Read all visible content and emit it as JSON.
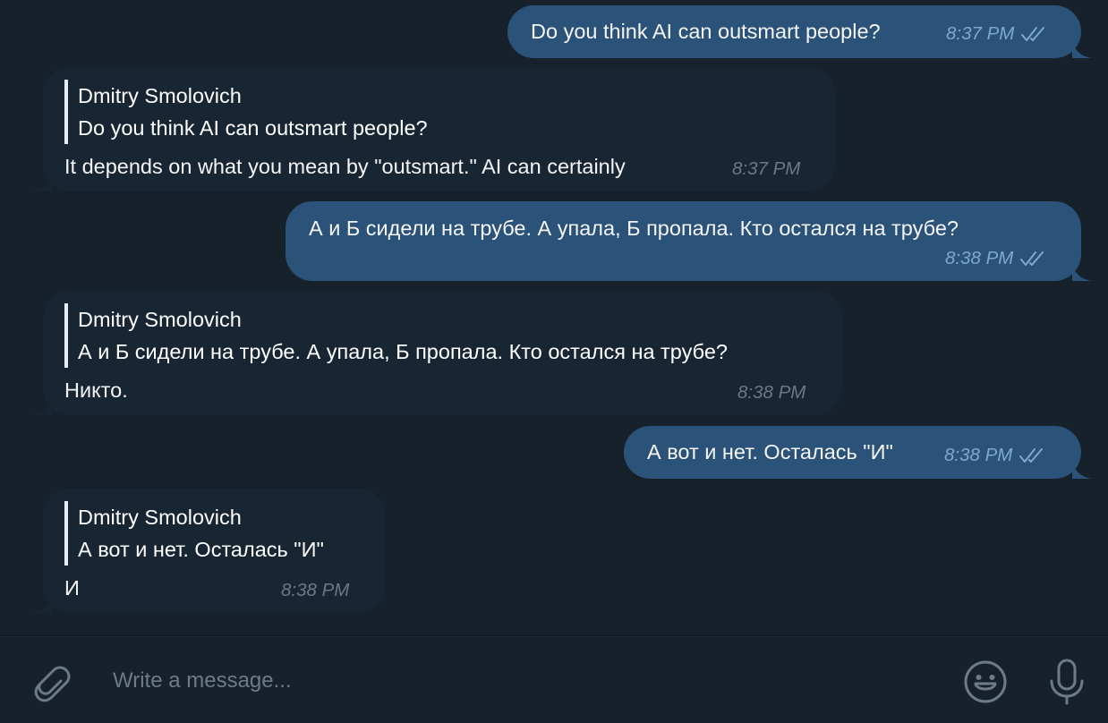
{
  "messages": [
    {
      "direction": "out",
      "text": "Do you think AI can outsmart people?",
      "time": "8:37 PM",
      "read": true
    },
    {
      "direction": "in",
      "reply_sender": "Dmitry Smolovich",
      "reply_text": "Do you think AI can outsmart people?",
      "text": "It depends on what you mean by \"outsmart.\" AI can certainly",
      "time": "8:37 PM"
    },
    {
      "direction": "out",
      "text": "А и Б сидели на трубе. А упала, Б пропала. Кто остался на трубе?",
      "time": "8:38 PM",
      "read": true
    },
    {
      "direction": "in",
      "reply_sender": "Dmitry Smolovich",
      "reply_text": "А и Б сидели на трубе. А упала, Б пропала. Кто остался на трубе?",
      "text": "Никто.",
      "time": "8:38 PM"
    },
    {
      "direction": "out",
      "text": "А вот и нет. Осталась \"И\"",
      "time": "8:38 PM",
      "read": true
    },
    {
      "direction": "in",
      "reply_sender": "Dmitry Smolovich",
      "reply_text": "А вот и нет. Осталась \"И\"",
      "text": "И",
      "time": "8:38 PM"
    }
  ],
  "composer": {
    "placeholder": "Write a message...",
    "value": "",
    "attach_icon": "paperclip-icon",
    "emoji_icon": "smile-icon",
    "voice_icon": "microphone-icon"
  },
  "colors": {
    "background": "#17212b",
    "outgoing_bubble": "#2b5278",
    "incoming_bubble": "#182533",
    "outgoing_meta": "#7da8d3",
    "incoming_meta": "#6c7883",
    "icon": "#6d7b89"
  }
}
